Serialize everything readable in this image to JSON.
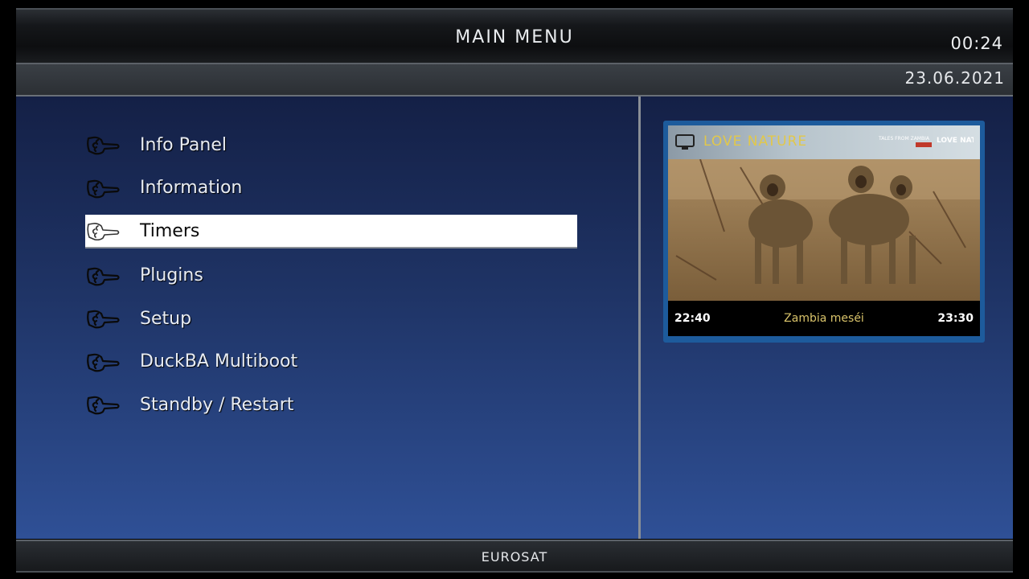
{
  "header": {
    "title": "Main Menu",
    "time": "00:24",
    "date": "23.06.2021"
  },
  "menu": {
    "items": [
      {
        "label": "Info Panel",
        "selected": false
      },
      {
        "label": "Information",
        "selected": false
      },
      {
        "label": "Timers",
        "selected": true
      },
      {
        "label": "Plugins",
        "selected": false
      },
      {
        "label": "Setup",
        "selected": false
      },
      {
        "label": "DuckBA Multiboot",
        "selected": false
      },
      {
        "label": "Standby / Restart",
        "selected": false
      }
    ]
  },
  "preview": {
    "channel_name": "LOVE NATURE",
    "channel_icon": "tv-icon",
    "logo_text_small": "TALES FROM ZAMBIA",
    "logo_text": "LOVE NATURE",
    "epg": {
      "start": "22:40",
      "title": "Zambia meséi",
      "end": "23:30"
    }
  },
  "footer": {
    "brand": "EUROSAT"
  },
  "colors": {
    "selected_bg": "#ffffff",
    "channel_text": "#e2c84a",
    "epg_title": "#d9c36a",
    "frame_blue": "#1d5b9c"
  }
}
